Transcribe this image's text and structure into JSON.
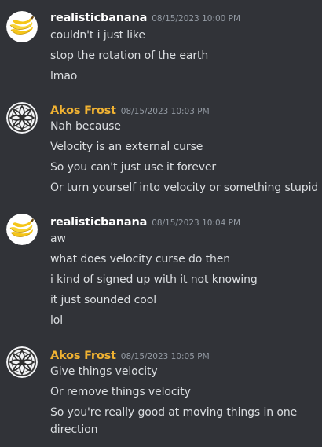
{
  "colors": {
    "background": "#313338",
    "message_text": "#dbdee1",
    "timestamp": "#949ba4",
    "user_realisticbanana": "#ffffff",
    "user_akos_frost": "#f0b232"
  },
  "messages": [
    {
      "username": "realisticbanana",
      "timestamp": "08/15/2023 10:00 PM",
      "avatar_icon": "banana-avatar",
      "lines": [
        "couldn't i just like",
        "stop the rotation of the earth",
        "lmao"
      ]
    },
    {
      "username": "Akos Frost",
      "timestamp": "08/15/2023 10:03 PM",
      "avatar_icon": "mandala-avatar",
      "lines": [
        "Nah because",
        "Velocity is an external curse",
        "So you can't just use it forever",
        "Or turn yourself into velocity or something stupid"
      ]
    },
    {
      "username": "realisticbanana",
      "timestamp": "08/15/2023 10:04 PM",
      "avatar_icon": "banana-avatar",
      "lines": [
        "aw",
        "what does velocity curse do then",
        "i kind of signed up with it not knowing",
        "it just sounded cool",
        "lol"
      ]
    },
    {
      "username": "Akos Frost",
      "timestamp": "08/15/2023 10:05 PM",
      "avatar_icon": "mandala-avatar",
      "lines": [
        "Give things velocity",
        "Or remove things velocity",
        "So you're really good at moving things in one direction"
      ]
    }
  ]
}
